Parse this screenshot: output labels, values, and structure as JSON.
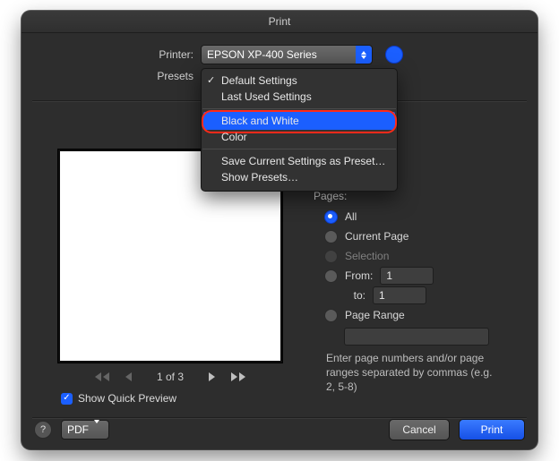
{
  "window": {
    "title": "Print"
  },
  "printer": {
    "label": "Printer:",
    "selected": "EPSON XP-400 Series"
  },
  "presets": {
    "label": "Presets",
    "menu": [
      "Default Settings",
      "Last Used Settings",
      "Black and White",
      "Color",
      "Save Current Settings as Preset…",
      "Show Presets…"
    ],
    "checked_index": 0,
    "highlighted_index": 2
  },
  "preview": {
    "page_indicator": "1 of 3",
    "quick_preview_label": "Show Quick Preview",
    "quick_preview_checked": true
  },
  "pages": {
    "heading": "Pages:",
    "options": {
      "all": "All",
      "current": "Current Page",
      "selection": "Selection",
      "from_label": "From:",
      "to_label": "to:",
      "range": "Page Range"
    },
    "selected": "all",
    "from_value": "1",
    "to_value": "1",
    "range_value": "",
    "hint": "Enter page numbers and/or page ranges separated by commas (e.g. 2, 5-8)"
  },
  "footer": {
    "pdf_label": "PDF",
    "cancel": "Cancel",
    "print": "Print"
  }
}
